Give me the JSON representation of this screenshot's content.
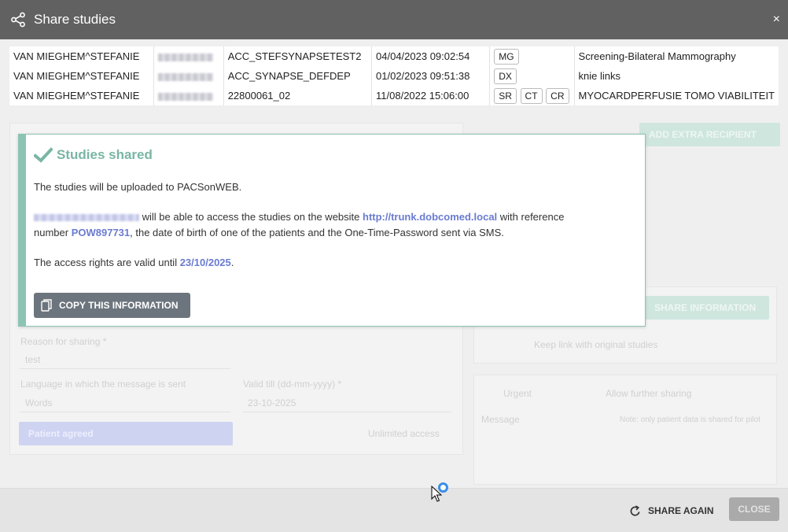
{
  "window": {
    "title": "Share studies",
    "close_glyph": "×",
    "icon": "share-icon"
  },
  "studies": [
    {
      "patient": "VAN MIEGHEM^STEFANIE",
      "accession": "ACC_STEFSYNAPSETEST2",
      "date": "04/04/2023 09:02:54",
      "modalities": [
        "MG"
      ],
      "description": "Screening-Bilateral Mammography"
    },
    {
      "patient": "VAN MIEGHEM^STEFANIE",
      "accession": "ACC_SYNAPSE_DEFDEP",
      "date": "01/02/2023 09:51:38",
      "modalities": [
        "DX"
      ],
      "description": "knie links"
    },
    {
      "patient": "VAN MIEGHEM^STEFANIE",
      "accession": "22800061_02",
      "date": "11/08/2022 15:06:00",
      "modalities": [
        "SR",
        "CT",
        "CR"
      ],
      "description": "MYOCARDPERFUSIE TOMO VIABILITEIT"
    }
  ],
  "background_form": {
    "reason_label": "Reason for sharing *",
    "reason_value": "test",
    "language_label": "Language in which the message is sent",
    "language_value": "Words",
    "valid_till_label": "Valid till (dd-mm-yyyy) *",
    "valid_till_value": "23-10-2025",
    "patient_agreed_label": "Patient agreed",
    "unlimited_label": "Unlimited access",
    "add_recipient_label": "ADD EXTRA RECIPIENT",
    "share_info_label": "SHARE INFORMATION",
    "keep_link_label": "Keep link with original studies",
    "urgent_label": "Urgent",
    "allow_sharing_label": "Allow further sharing",
    "message_label": "Message",
    "message_hint": "Note: only patient data is shared for pilot"
  },
  "popup": {
    "title": "Studies shared",
    "check_icon": "check-icon",
    "line1": "The studies will be uploaded to PACSonWEB.",
    "line2_mid": " will be able to access the studies on the website ",
    "website": "http://trunk.dobcomed.local",
    "line2_end": " with reference",
    "line3_start": "number ",
    "reference": "POW897731",
    "line3_end": ", the date of birth of one of the patients and the One-Time-Password sent via SMS.",
    "line4_start": "The access rights are valid until ",
    "valid_until": "23/10/2025",
    "line4_end": ".",
    "copy_button": "COPY THIS INFORMATION",
    "accent_color": "#8cc4b4",
    "link_color": "#6a7bd1"
  },
  "footer": {
    "share_again": "SHARE AGAIN",
    "close": "CLOSE"
  }
}
